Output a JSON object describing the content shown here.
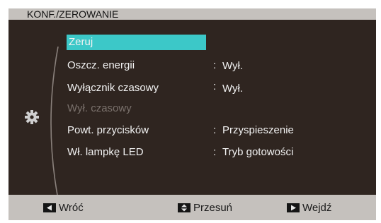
{
  "title": "KONF./ZEROWANIE",
  "menu": [
    {
      "label": "Zeruj",
      "value": "",
      "selected": true,
      "disabled": false
    },
    {
      "label": "Oszcz. energii",
      "value": "Wył.",
      "selected": false,
      "disabled": false
    },
    {
      "label": "Wyłącznik czasowy",
      "value": "Wył.",
      "selected": false,
      "disabled": false
    },
    {
      "label": "Wył. czasowy",
      "value": "",
      "selected": false,
      "disabled": true
    },
    {
      "label": "Powt. przycisków",
      "value": "Przyspieszenie",
      "selected": false,
      "disabled": false
    },
    {
      "label": "Wł. lampkę LED",
      "value": "Tryb gotowości",
      "selected": false,
      "disabled": false
    }
  ],
  "separator": ":",
  "footer": {
    "back_label": "Wróć",
    "move_label": "Przesuń",
    "enter_label": "Wejdź"
  },
  "colors": {
    "background": "#2f2520",
    "bar": "#c5c1bd",
    "selection": "#3cc8c8"
  },
  "icons": {
    "category": "gear-icon",
    "back": "triangle-left-icon",
    "move": "up-down-arrows-icon",
    "enter": "triangle-right-icon"
  }
}
